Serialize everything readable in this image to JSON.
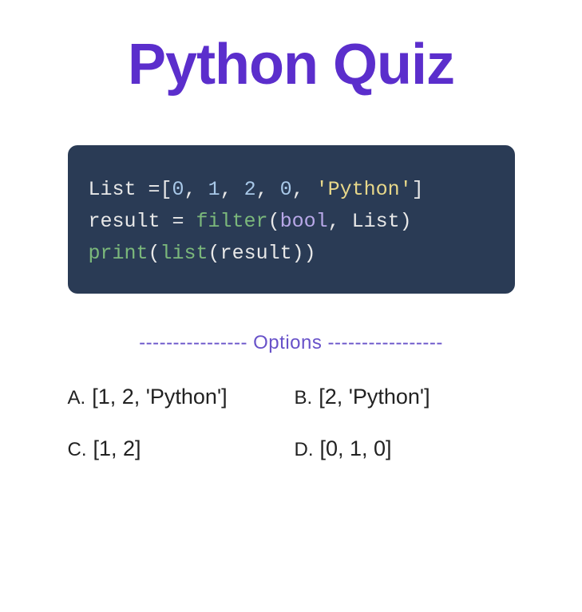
{
  "title": "Python Quiz",
  "code": {
    "line1": {
      "var": "List ",
      "eq": "=",
      "lb": "[",
      "n1": "0",
      "c1": ", ",
      "n2": "1",
      "c2": ", ",
      "n3": "2",
      "c3": ", ",
      "n4": "0",
      "c4": ", ",
      "str": "'Python'",
      "rb": "]"
    },
    "line2": {
      "var": "result ",
      "eq": "= ",
      "fn": "filter",
      "lp": "(",
      "builtin": "bool",
      "comma": ", ",
      "arg": "List",
      "rp": ")"
    },
    "line3": {
      "fn1": "print",
      "lp1": "(",
      "fn2": "list",
      "lp2": "(",
      "arg": "result",
      "rp2": ")",
      "rp1": ")"
    }
  },
  "options_header": "---------------- Options -----------------",
  "options": {
    "a": {
      "letter": "A.",
      "value": "[1, 2, 'Python']"
    },
    "b": {
      "letter": "B.",
      "value": "[2, 'Python']"
    },
    "c": {
      "letter": "C.",
      "value": "[1, 2]"
    },
    "d": {
      "letter": "D.",
      "value": "[0, 1, 0]"
    }
  }
}
